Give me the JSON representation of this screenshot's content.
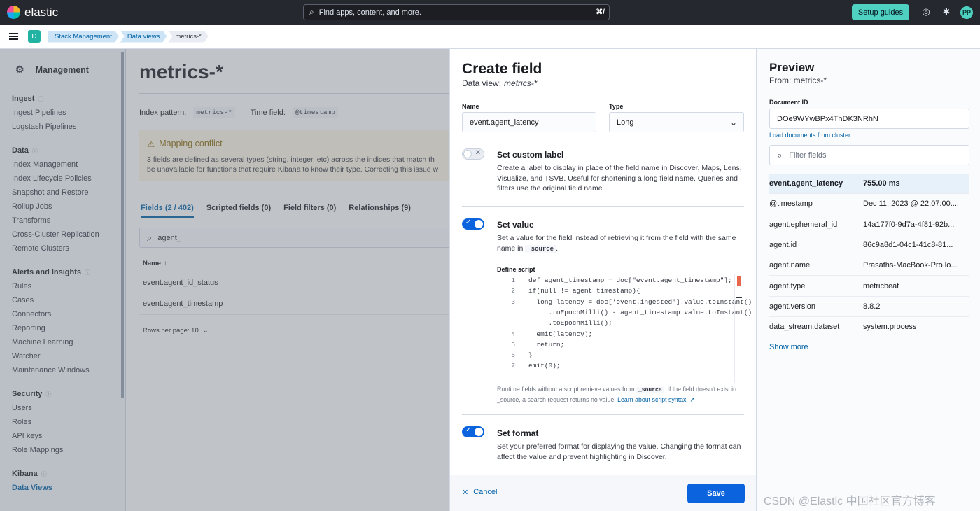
{
  "topbar": {
    "brand": "elastic",
    "search_placeholder": "Find apps, content, and more.",
    "search_shortcut": "⌘/",
    "setup_guides": "Setup guides",
    "avatar_initials": "PP"
  },
  "breadcrumbs": {
    "space_initial": "D",
    "items": [
      "Stack Management",
      "Data views",
      "metrics-*"
    ]
  },
  "sidebar": {
    "title": "Management",
    "groups": [
      {
        "label": "Ingest",
        "items": [
          "Ingest Pipelines",
          "Logstash Pipelines"
        ]
      },
      {
        "label": "Data",
        "items": [
          "Index Management",
          "Index Lifecycle Policies",
          "Snapshot and Restore",
          "Rollup Jobs",
          "Transforms",
          "Cross-Cluster Replication",
          "Remote Clusters"
        ]
      },
      {
        "label": "Alerts and Insights",
        "items": [
          "Rules",
          "Cases",
          "Connectors",
          "Reporting",
          "Machine Learning",
          "Watcher",
          "Maintenance Windows"
        ]
      },
      {
        "label": "Security",
        "items": [
          "Users",
          "Roles",
          "API keys",
          "Role Mappings"
        ]
      },
      {
        "label": "Kibana",
        "items": [
          "Data Views"
        ]
      }
    ]
  },
  "main": {
    "title": "metrics-*",
    "index_pattern_label": "Index pattern:",
    "index_pattern_value": "metrics-*",
    "time_field_label": "Time field:",
    "time_field_value": "@timestamp",
    "callout_title": "Mapping conflict",
    "callout_line1": "3 fields are defined as several types (string, integer, etc) across the indices that match th",
    "callout_line2": "be unavailable for functions that require Kibana to know their type. Correcting this issue w",
    "tabs": [
      "Fields (2 / 402)",
      "Scripted fields (0)",
      "Field filters (0)",
      "Relationships (9)"
    ],
    "search_value": "agent_",
    "column_name": "Name",
    "rows": [
      "event.agent_id_status",
      "event.agent_timestamp"
    ],
    "rows_per_page": "Rows per page: 10"
  },
  "flyout": {
    "title": "Create field",
    "subtitle_prefix": "Data view:",
    "subtitle_view": "metrics-*",
    "name_label": "Name",
    "name_value": "event.agent_latency",
    "type_label": "Type",
    "type_value": "Long",
    "custom_label": {
      "title": "Set custom label",
      "desc": "Create a label to display in place of the field name in Discover, Maps, Lens, Visualize, and TSVB. Useful for shortening a long field name. Queries and filters use the original field name."
    },
    "set_value": {
      "title": "Set value",
      "desc_part1": "Set a value for the field instead of retrieving it from the field with the same name in",
      "desc_code": "_source",
      "desc_part2": "."
    },
    "script_label": "Define script",
    "script_lines": [
      {
        "n": "1",
        "t": "def agent_timestamp = doc[\"event.agent_timestamp\"];"
      },
      {
        "n": "2",
        "t": "if(null != agent_timestamp){"
      },
      {
        "n": "3",
        "t": "  long latency = doc['event.ingested'].value.toInstant()"
      },
      {
        "n": "",
        "t": "     .toEpochMilli() - agent_timestamp.value.toInstant()"
      },
      {
        "n": "",
        "t": "     .toEpochMilli();"
      },
      {
        "n": "4",
        "t": "  emit(latency);"
      },
      {
        "n": "5",
        "t": "  return;"
      },
      {
        "n": "6",
        "t": "}"
      },
      {
        "n": "7",
        "t": "emit(0);"
      }
    ],
    "help_part1": "Runtime fields without a script retrieve values from",
    "help_code": "_source",
    "help_part2": ". If the field doesn't exist in _source, a search request returns no value.",
    "help_link": "Learn about script syntax.",
    "set_format": {
      "title": "Set format",
      "desc": "Set your preferred format for displaying the value. Changing the format can affect the value and prevent highlighting in Discover."
    },
    "cancel": "Cancel",
    "save": "Save"
  },
  "preview": {
    "title": "Preview",
    "from": "From: metrics-*",
    "doc_id_label": "Document ID",
    "doc_id_value": "DOe9WYwBPx4ThDK3NRhN",
    "load_link": "Load documents from cluster",
    "filter_placeholder": "Filter fields",
    "fields": [
      {
        "name": "event.agent_latency",
        "value": "755.00 ms"
      },
      {
        "name": "@timestamp",
        "value": "Dec 11, 2023 @ 22:07:00...."
      },
      {
        "name": "agent.ephemeral_id",
        "value": "14a177f0-9d7a-4f81-92b..."
      },
      {
        "name": "agent.id",
        "value": "86c9a8d1-04c1-41c8-81..."
      },
      {
        "name": "agent.name",
        "value": "Prasaths-MacBook-Pro.lo..."
      },
      {
        "name": "agent.type",
        "value": "metricbeat"
      },
      {
        "name": "agent.version",
        "value": "8.8.2"
      },
      {
        "name": "data_stream.dataset",
        "value": "system.process"
      }
    ],
    "show_more": "Show more"
  },
  "watermark": "CSDN @Elastic 中国社区官方博客",
  "colors": {
    "accent": "#0b64dd",
    "topbar": "#25282f",
    "setup": "#4fd1c1"
  }
}
